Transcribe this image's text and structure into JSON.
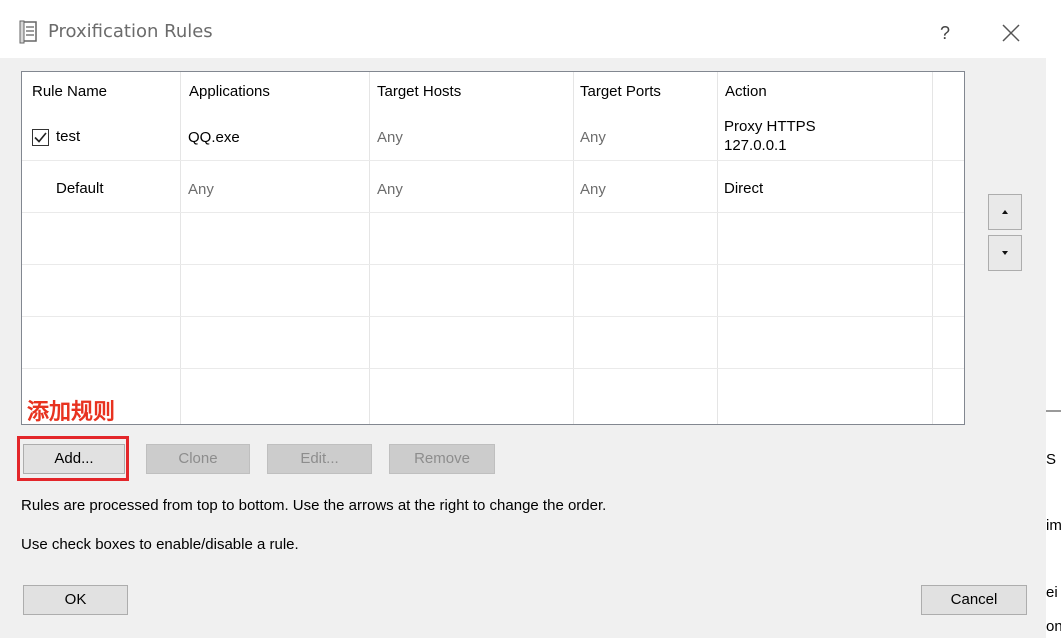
{
  "window": {
    "title": "Proxification Rules",
    "help": "?"
  },
  "table": {
    "columns": [
      "Rule Name",
      "Applications",
      "Target Hosts",
      "Target Ports",
      "Action"
    ],
    "rows": [
      {
        "enabled": true,
        "name": "test",
        "applications": "QQ.exe",
        "hosts": "Any",
        "ports": "Any",
        "action_line1": "Proxy HTTPS",
        "action_line2": "127.0.0.1"
      },
      {
        "name": "Default",
        "applications": "Any",
        "hosts": "Any",
        "ports": "Any",
        "action_line1": "Direct"
      }
    ]
  },
  "annotation": "添加规则",
  "buttons": {
    "add": "Add...",
    "clone": "Clone",
    "edit": "Edit...",
    "remove": "Remove",
    "ok": "OK",
    "cancel": "Cancel"
  },
  "info": {
    "line1": "Rules are processed from top to bottom. Use the arrows at the right to change the order.",
    "line2": "Use check boxes to enable/disable a rule."
  },
  "background_fragments": [
    "S",
    "im",
    "ei",
    "on"
  ],
  "colors": {
    "annotation_red": "#e8321f",
    "highlight_red": "#e3262a",
    "dialog_bg": "#f0f0f0"
  },
  "icons": {
    "title": "document-icon",
    "close": "close-icon",
    "move_up": "arrow-up-icon",
    "move_down": "arrow-down-icon",
    "checkbox": "checkmark-icon"
  }
}
